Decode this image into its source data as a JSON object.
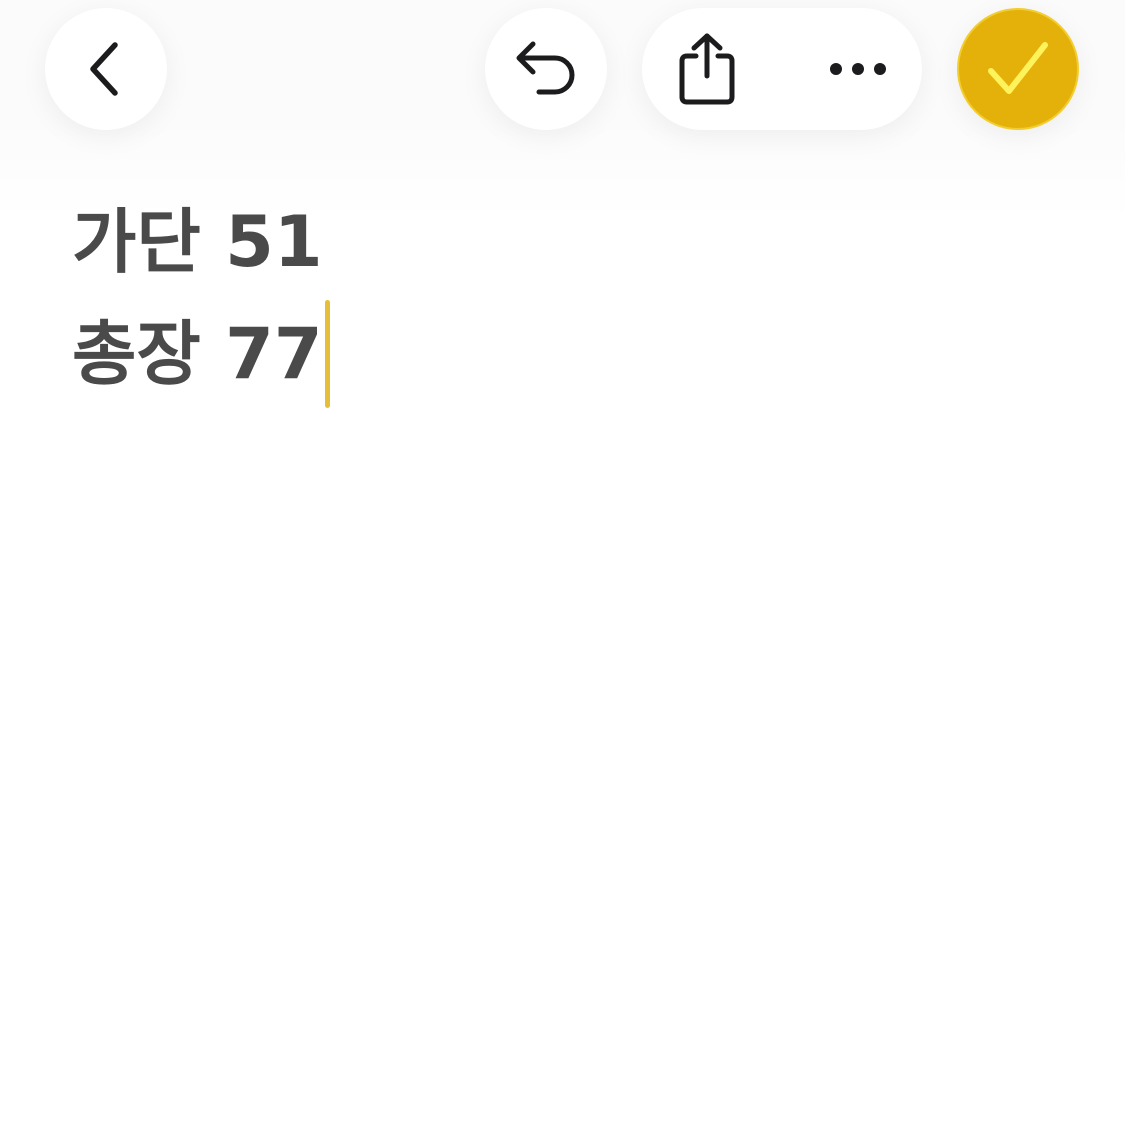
{
  "toolbar": {
    "back_icon": "chevron-left-icon",
    "undo_icon": "undo-arrow-icon",
    "share_icon": "share-icon",
    "more_icon": "ellipsis-icon",
    "done_icon": "checkmark-icon"
  },
  "note": {
    "lines": [
      "가단 51",
      "총장 77"
    ]
  },
  "colors": {
    "accent": "#e4b10a",
    "accent_check": "#fff35c",
    "caret": "#e6bf3a",
    "text": "#4a4a4a",
    "icon": "#1c1c1e"
  }
}
